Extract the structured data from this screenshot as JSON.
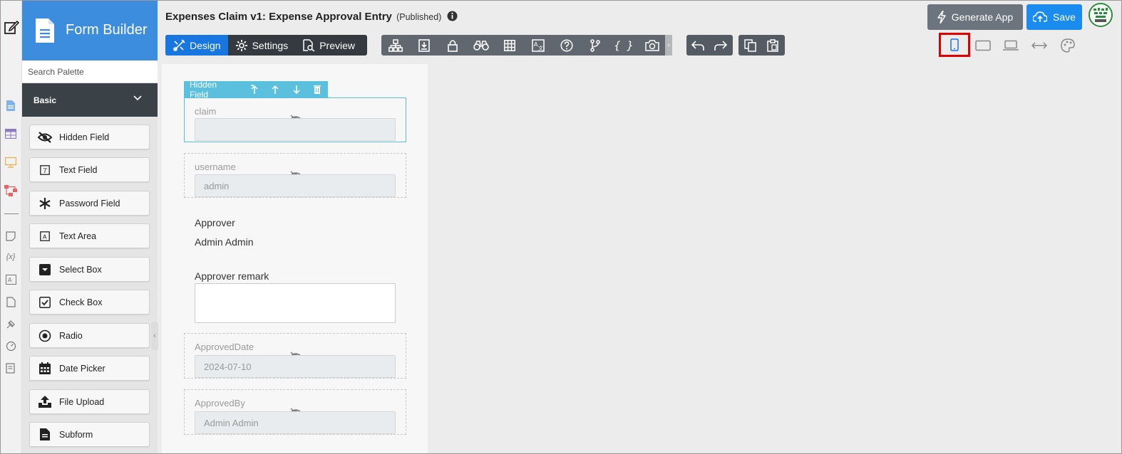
{
  "app": {
    "title": "Form Builder"
  },
  "form": {
    "title": "Expenses Claim v1: Expense Approval Entry",
    "status": "(Published)"
  },
  "palette": {
    "search_placeholder": "Search Palette",
    "category": "Basic",
    "items": [
      {
        "label": "Hidden Field",
        "icon": "eye-slash-icon"
      },
      {
        "label": "Text Field",
        "icon": "text-field-icon"
      },
      {
        "label": "Password Field",
        "icon": "asterisk-icon"
      },
      {
        "label": "Text Area",
        "icon": "text-area-icon"
      },
      {
        "label": "Select Box",
        "icon": "select-box-icon"
      },
      {
        "label": "Check Box",
        "icon": "check-box-icon"
      },
      {
        "label": "Radio",
        "icon": "radio-icon"
      },
      {
        "label": "Date Picker",
        "icon": "calendar-icon"
      },
      {
        "label": "File Upload",
        "icon": "upload-icon"
      },
      {
        "label": "Subform",
        "icon": "subform-icon"
      }
    ]
  },
  "tabs": {
    "design": "Design",
    "settings": "Settings",
    "preview": "Preview"
  },
  "buttons": {
    "generate": "Generate App",
    "save": "Save"
  },
  "selection": {
    "label": "Hidden Field"
  },
  "fields": {
    "claim": {
      "label": "claim",
      "value": ""
    },
    "username": {
      "label": "username",
      "value": "admin"
    },
    "approver": {
      "label": "Approver",
      "value": "Admin Admin"
    },
    "approver_remark": {
      "label": "Approver remark"
    },
    "approved_date": {
      "label": "ApprovedDate",
      "value": "2024-07-10"
    },
    "approved_by": {
      "label": "ApprovedBy",
      "value": "Admin Admin"
    }
  },
  "colors": {
    "brand": "#3c8dde",
    "active_tab": "#1776e0",
    "save": "#1a8cf0",
    "selection": "#5bc0de",
    "highlight": "#e00000"
  }
}
